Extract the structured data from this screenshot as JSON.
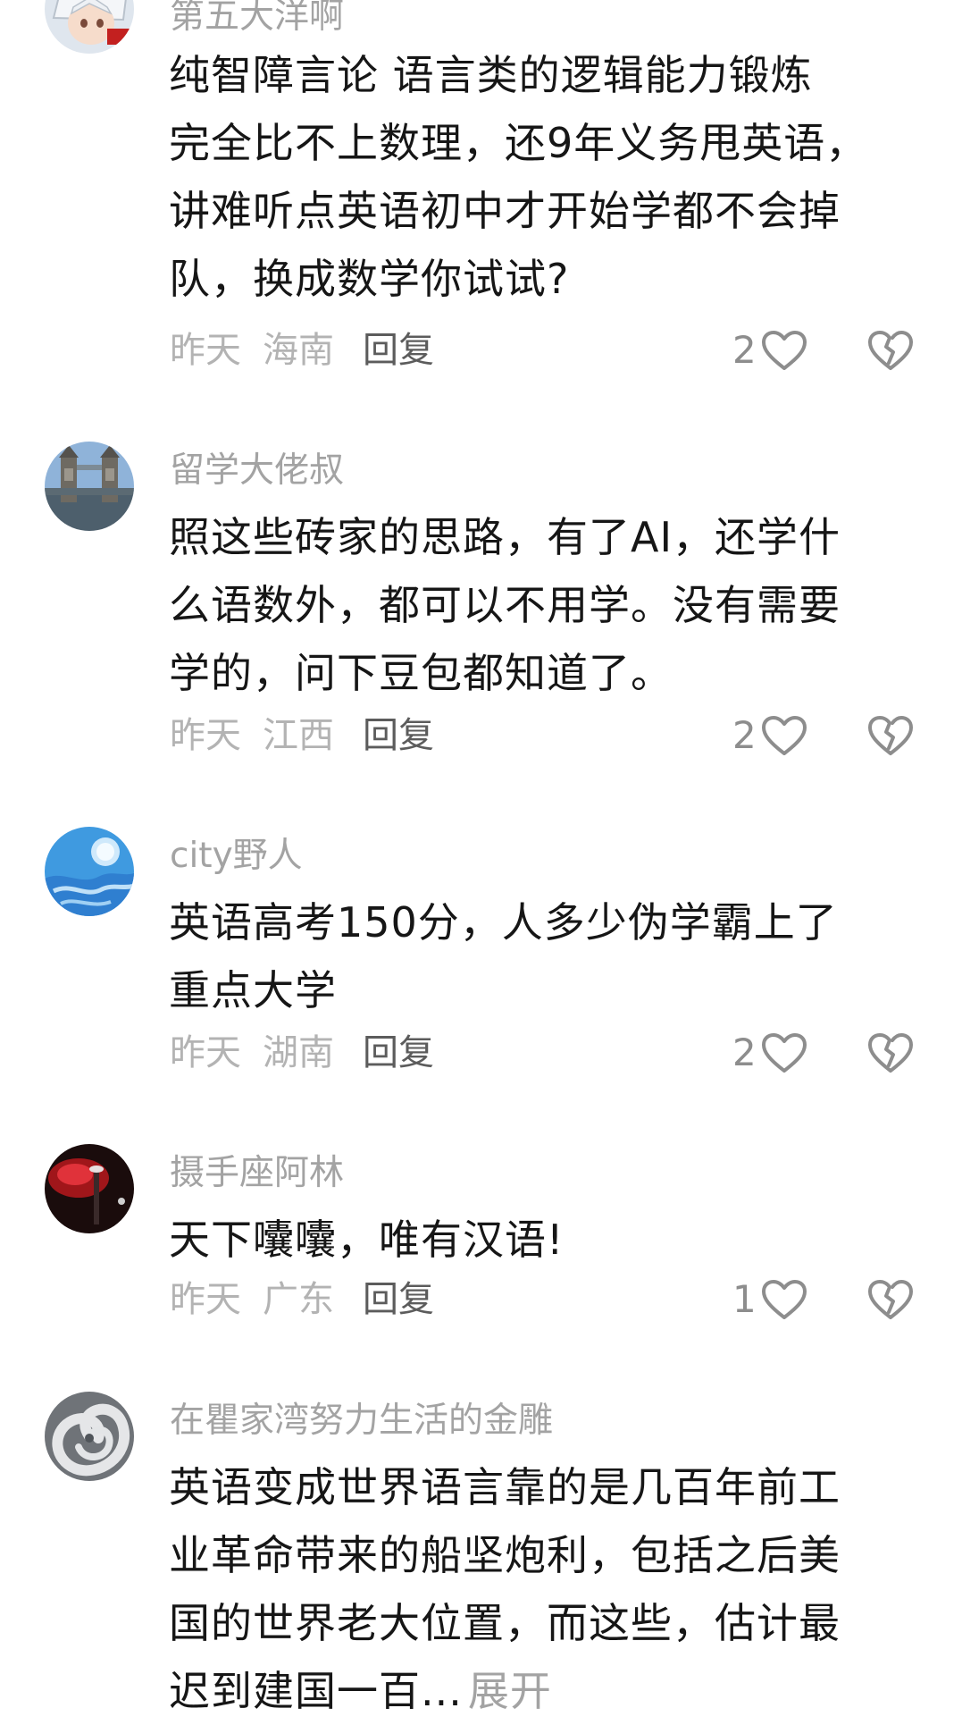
{
  "comments": [
    {
      "username": "第五大洋啊",
      "lines": [
        "纯智障言论 语言类的逻辑能力锻炼",
        "完全比不上数理，还9年义务甩英语，",
        "讲难听点英语初中才开始学都不会掉",
        "队，换成数学你试试?"
      ],
      "time": "昨天",
      "location": "海南",
      "reply": "回复",
      "likes": "2",
      "avatar_icon": "anime-character-avatar"
    },
    {
      "username": "留学大佬叔",
      "lines": [
        "照这些砖家的思路，有了AI，还学什",
        "么语数外，都可以不用学。没有需要",
        "学的，问下豆包都知道了。"
      ],
      "time": "昨天",
      "location": "江西",
      "reply": "回复",
      "likes": "2",
      "avatar_icon": "tower-bridge-avatar"
    },
    {
      "username": "city野人",
      "lines": [
        "英语高考150分，人多少伪学霸上了",
        "重点大学"
      ],
      "time": "昨天",
      "location": "湖南",
      "reply": "回复",
      "likes": "2",
      "avatar_icon": "blue-sky-avatar"
    },
    {
      "username": "摄手座阿林",
      "lines": [
        "天下囔囔，唯有汉语!"
      ],
      "time": "昨天",
      "location": "广东",
      "reply": "回复",
      "likes": "1",
      "avatar_icon": "red-light-avatar"
    },
    {
      "username": "在瞿家湾努力生活的金雕",
      "lines": [
        "英语变成世界语言靠的是几百年前工",
        "业革命带来的船坚炮利，包括之后美",
        "国的世界老大位置，而这些，估计最",
        "迟到建国一百..."
      ],
      "expand": "展开",
      "avatar_icon": "hurricane-avatar"
    }
  ],
  "colors": {
    "text": "#161616",
    "muted": "#a3a3a3",
    "reply": "#5c5c5c",
    "icon": "#8d8d8d"
  }
}
